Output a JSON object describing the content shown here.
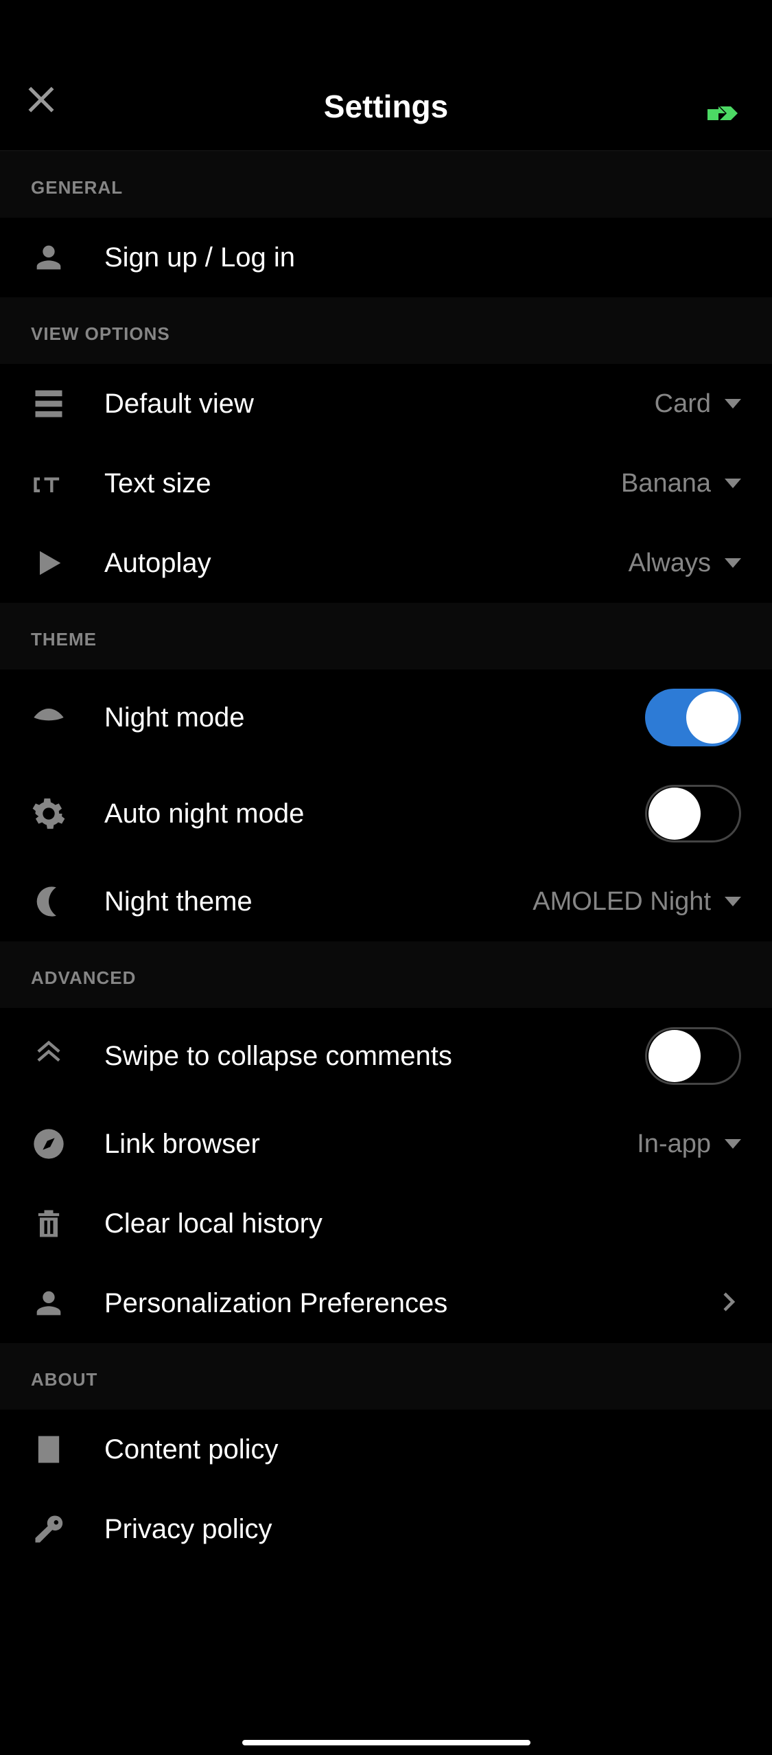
{
  "statusBar": {
    "batteryCharging": true
  },
  "header": {
    "title": "Settings"
  },
  "sections": {
    "general": {
      "header": "GENERAL",
      "signup": "Sign up / Log in"
    },
    "viewOptions": {
      "header": "VIEW OPTIONS",
      "defaultView": {
        "label": "Default view",
        "value": "Card"
      },
      "textSize": {
        "label": "Text size",
        "value": "Banana"
      },
      "autoplay": {
        "label": "Autoplay",
        "value": "Always"
      }
    },
    "theme": {
      "header": "THEME",
      "nightMode": {
        "label": "Night mode",
        "value": true
      },
      "autoNightMode": {
        "label": "Auto night mode",
        "value": false
      },
      "nightTheme": {
        "label": "Night theme",
        "value": "AMOLED Night"
      }
    },
    "advanced": {
      "header": "ADVANCED",
      "swipeCollapse": {
        "label": "Swipe to collapse comments",
        "value": false
      },
      "linkBrowser": {
        "label": "Link browser",
        "value": "In-app"
      },
      "clearHistory": "Clear local history",
      "personalization": "Personalization Preferences"
    },
    "about": {
      "header": "ABOUT",
      "contentPolicy": "Content policy",
      "privacyPolicy": "Privacy policy"
    }
  }
}
